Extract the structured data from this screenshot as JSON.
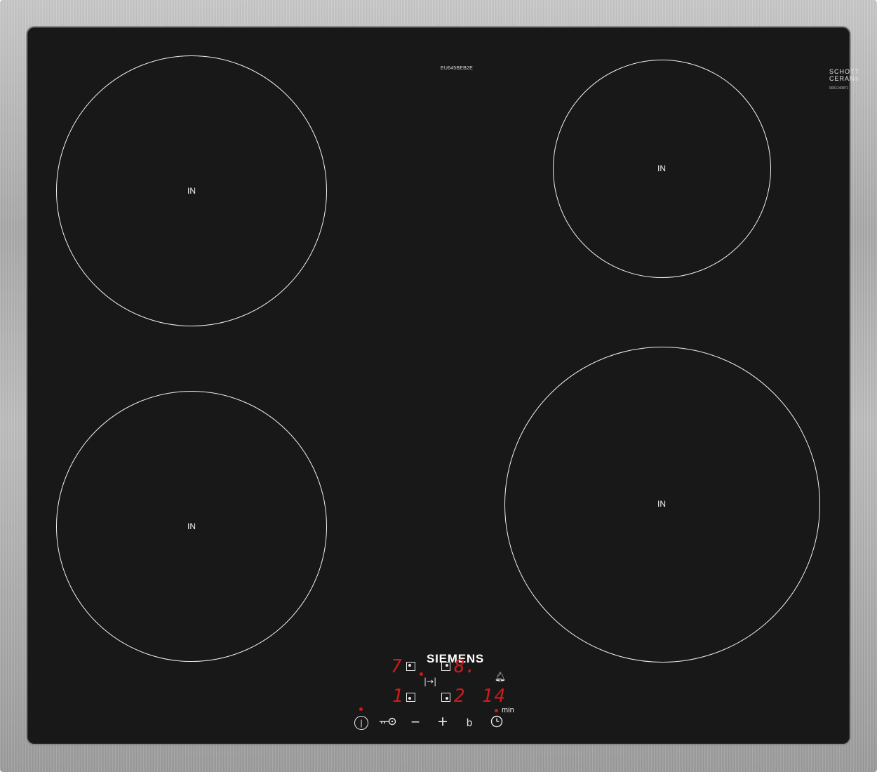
{
  "product": {
    "model_number": "EU645BEB2E",
    "brand": "SIEMENS",
    "glass_brand_line1": "SCHOTT",
    "glass_brand_line2": "CERAN",
    "glass_brand_reg": "®",
    "serial": "9001140871"
  },
  "zones": [
    {
      "id": "rear-left",
      "label": "IN"
    },
    {
      "id": "rear-right",
      "label": "IN"
    },
    {
      "id": "front-left",
      "label": "IN"
    },
    {
      "id": "front-right",
      "label": "IN"
    }
  ],
  "display": {
    "rear_left_level": "7",
    "rear_right_level": "8.",
    "front_left_level": "1",
    "front_right_level": "2",
    "timer_value": "14",
    "timer_unit": "min"
  },
  "controls": {
    "power_symbol": "|",
    "minus_symbol": "−",
    "plus_symbol": "+",
    "boost_symbol": "b",
    "icons": [
      "power-icon",
      "childlock-key-icon",
      "minus-icon",
      "plus-icon",
      "boost-icon",
      "timer-clock-icon",
      "alarm-bell-icon",
      "power-transfer-icon"
    ]
  },
  "colors": {
    "glass": "#181818",
    "frame": "#b4b4b4",
    "display_red": "#d01a1a",
    "markings": "#f0f0f0"
  }
}
